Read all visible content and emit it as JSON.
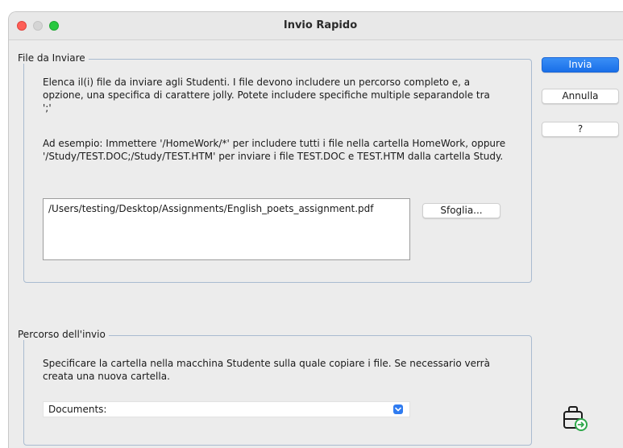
{
  "window": {
    "title": "Invio Rapido"
  },
  "files_group": {
    "legend": "File da Inviare",
    "description": "Elenca il(i) file da inviare agli Studenti. I file devono includere un percorso completo e, a opzione, una specifica di carattere jolly. Potete includere specifiche multiple separandole tra ';'",
    "example": "Ad esempio: Immettere '/HomeWork/*' per includere tutti i file nella cartella HomeWork, oppure '/Study/TEST.DOC;/Study/TEST.HTM' per inviare i file TEST.DOC e TEST.HTM dalla cartella Study.",
    "file_path_value": "/Users/testing/Desktop/Assignments/English_poets_assignment.pdf",
    "browse_label": "Sfoglia..."
  },
  "path_group": {
    "legend": "Percorso dell'invio",
    "description": "Specificare la cartella nella macchina Studente sulla quale copiare i file. Se necessario verrà creata una nuova cartella.",
    "selected_folder": "Documents:"
  },
  "buttons": {
    "send_label": "Invia",
    "cancel_label": "Annulla",
    "help_label": "?"
  },
  "icons": {
    "send_files": "briefcase-send-icon",
    "dropdown": "chevron-down-icon"
  },
  "colors": {
    "accent": "#1a6fe8",
    "group_border": "#a9bbd0",
    "close": "#fe5f57",
    "maximize": "#28c840",
    "send_icon_badge": "#2ea84a"
  }
}
